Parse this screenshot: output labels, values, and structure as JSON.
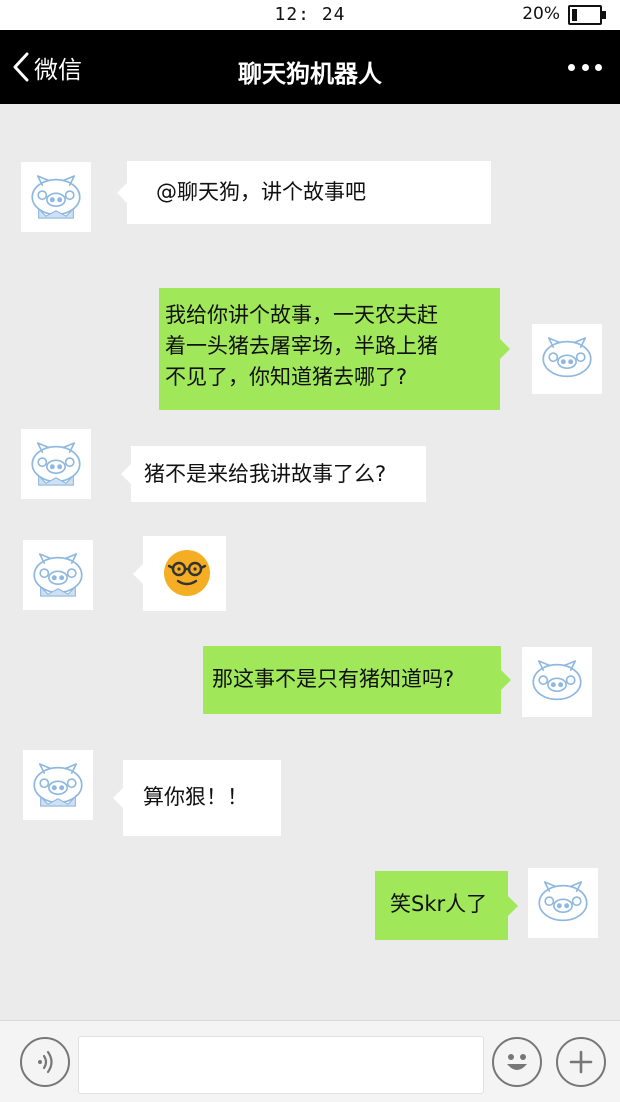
{
  "status_bar": {
    "time": "12: 24",
    "battery_percent": "20%",
    "battery_level": 0.2
  },
  "nav": {
    "back_label": "微信",
    "title": "聊天狗机器人",
    "more_icon": "more-dots-icon"
  },
  "messages": [
    {
      "side": "left",
      "avatar": "pig-face-icon",
      "lines": [
        "@聊天狗，讲个故事吧"
      ]
    },
    {
      "side": "right",
      "avatar": "pig-face-icon",
      "lines": [
        "我给你讲个故事，一天农夫赶",
        "着一头猪去屠宰场，半路上猪",
        "不见了，你知道猪去哪了?"
      ]
    },
    {
      "side": "left",
      "avatar": "pig-face-icon",
      "lines": [
        "猪不是来给我讲故事了么?"
      ]
    },
    {
      "side": "left",
      "avatar": "pig-face-icon",
      "sticker": "nerd-glasses-emoji"
    },
    {
      "side": "right",
      "avatar": "pig-face-icon",
      "lines": [
        "那这事不是只有猪知道吗?"
      ]
    },
    {
      "side": "left",
      "avatar": "pig-face-icon",
      "lines": [
        "算你狠！！"
      ]
    },
    {
      "side": "right",
      "avatar": "pig-face-icon",
      "lines": [
        "笑Skr人了"
      ]
    }
  ],
  "input_bar": {
    "voice_icon": "voice-icon",
    "text_value": "",
    "emoji_icon": "smiley-icon",
    "plus_icon": "plus-icon"
  },
  "colors": {
    "nav_bg": "#000000",
    "chat_bg": "#ebebeb",
    "outgoing_bubble": "#a0e75a",
    "incoming_bubble": "#ffffff",
    "avatar_stroke": "#8fb8e0",
    "emoji_yellow": "#f5ad24"
  }
}
